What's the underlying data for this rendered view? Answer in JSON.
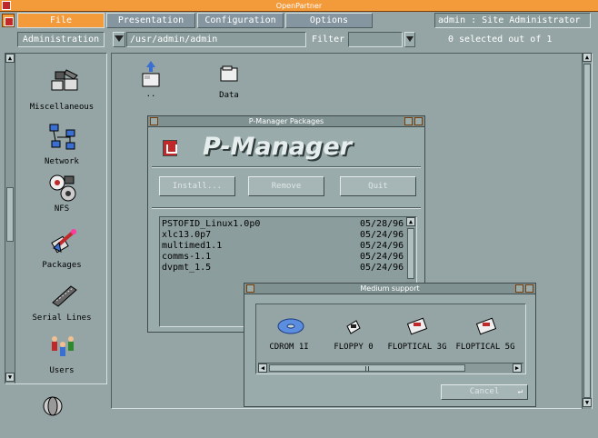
{
  "window": {
    "title": "OpenPartner"
  },
  "menu": {
    "items": [
      {
        "label": "File"
      },
      {
        "label": "Presentation"
      },
      {
        "label": "Configuration"
      },
      {
        "label": "Options"
      }
    ],
    "user": "admin : Site Administrator"
  },
  "toolbar": {
    "mode": "Administration",
    "path": "/usr/admin/admin",
    "filter_label": "Filter",
    "filter_value": "",
    "selection_status": "0 selected out of 1"
  },
  "sidebar": {
    "items": [
      {
        "label": "Miscellaneous",
        "icon": "miscellaneous-icon"
      },
      {
        "label": "Network",
        "icon": "network-icon"
      },
      {
        "label": "NFS",
        "icon": "nfs-icon"
      },
      {
        "label": "Packages",
        "icon": "packages-icon"
      },
      {
        "label": "Serial Lines",
        "icon": "serial-lines-icon"
      },
      {
        "label": "Users",
        "icon": "users-icon"
      }
    ]
  },
  "folders": [
    {
      "label": "..",
      "icon": "parent-folder-icon"
    },
    {
      "label": "Data",
      "icon": "folder-icon"
    }
  ],
  "pmanager": {
    "title": "P-Manager Packages",
    "banner": "P-Manager",
    "buttons": {
      "install": "Install...",
      "remove": "Remove",
      "quit": "Quit"
    },
    "packages": [
      {
        "name": "PSTOFID_Linux1.0p0",
        "date": "05/28/96"
      },
      {
        "name": "xlc13.0p7",
        "date": "05/24/96"
      },
      {
        "name": "multimed1.1",
        "date": "05/24/96"
      },
      {
        "name": "comms-1.1",
        "date": "05/24/96"
      },
      {
        "name": "dvpmt_1.5",
        "date": "05/24/96"
      }
    ]
  },
  "medium": {
    "title": "Medium support",
    "items": [
      {
        "label": "CDROM 1I",
        "icon": "cdrom-icon"
      },
      {
        "label": "FLOPPY 0",
        "icon": "floppy-icon"
      },
      {
        "label": "FLOPTICAL 3G",
        "icon": "floptical-icon"
      },
      {
        "label": "FLOPTICAL 5G",
        "icon": "floptical-icon"
      }
    ],
    "cancel": "Cancel"
  },
  "colors": {
    "accent": "#f39a3a",
    "background": "#95a5a5",
    "panel": "#9aabab"
  }
}
